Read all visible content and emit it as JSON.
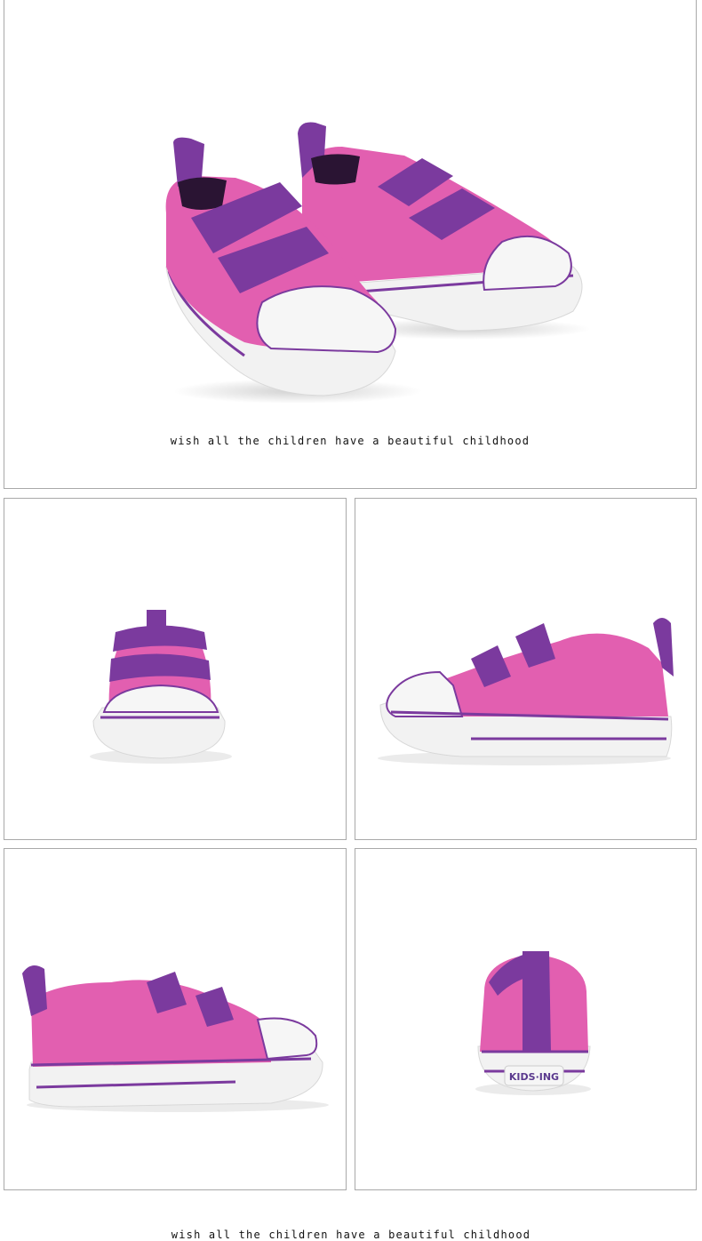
{
  "hero": {
    "caption": "wish all the children have a beautiful childhood",
    "image": "pink-velcro-kids-sneakers-pair"
  },
  "gallery": [
    {
      "view": "front",
      "image": "sneaker-front-view"
    },
    {
      "view": "side-right",
      "image": "sneaker-side-view"
    },
    {
      "view": "side-left",
      "image": "sneaker-side-view"
    },
    {
      "view": "back",
      "image": "sneaker-back-view",
      "heel_label": "KIDS·ING"
    }
  ],
  "footer": {
    "caption": "wish all the children have a beautiful childhood"
  },
  "colors": {
    "canvas_pink": "#e25fb0",
    "strap_purple": "#7b3a9e",
    "sole_white": "#f4f4f4",
    "panel_border": "#a9a9a9"
  }
}
